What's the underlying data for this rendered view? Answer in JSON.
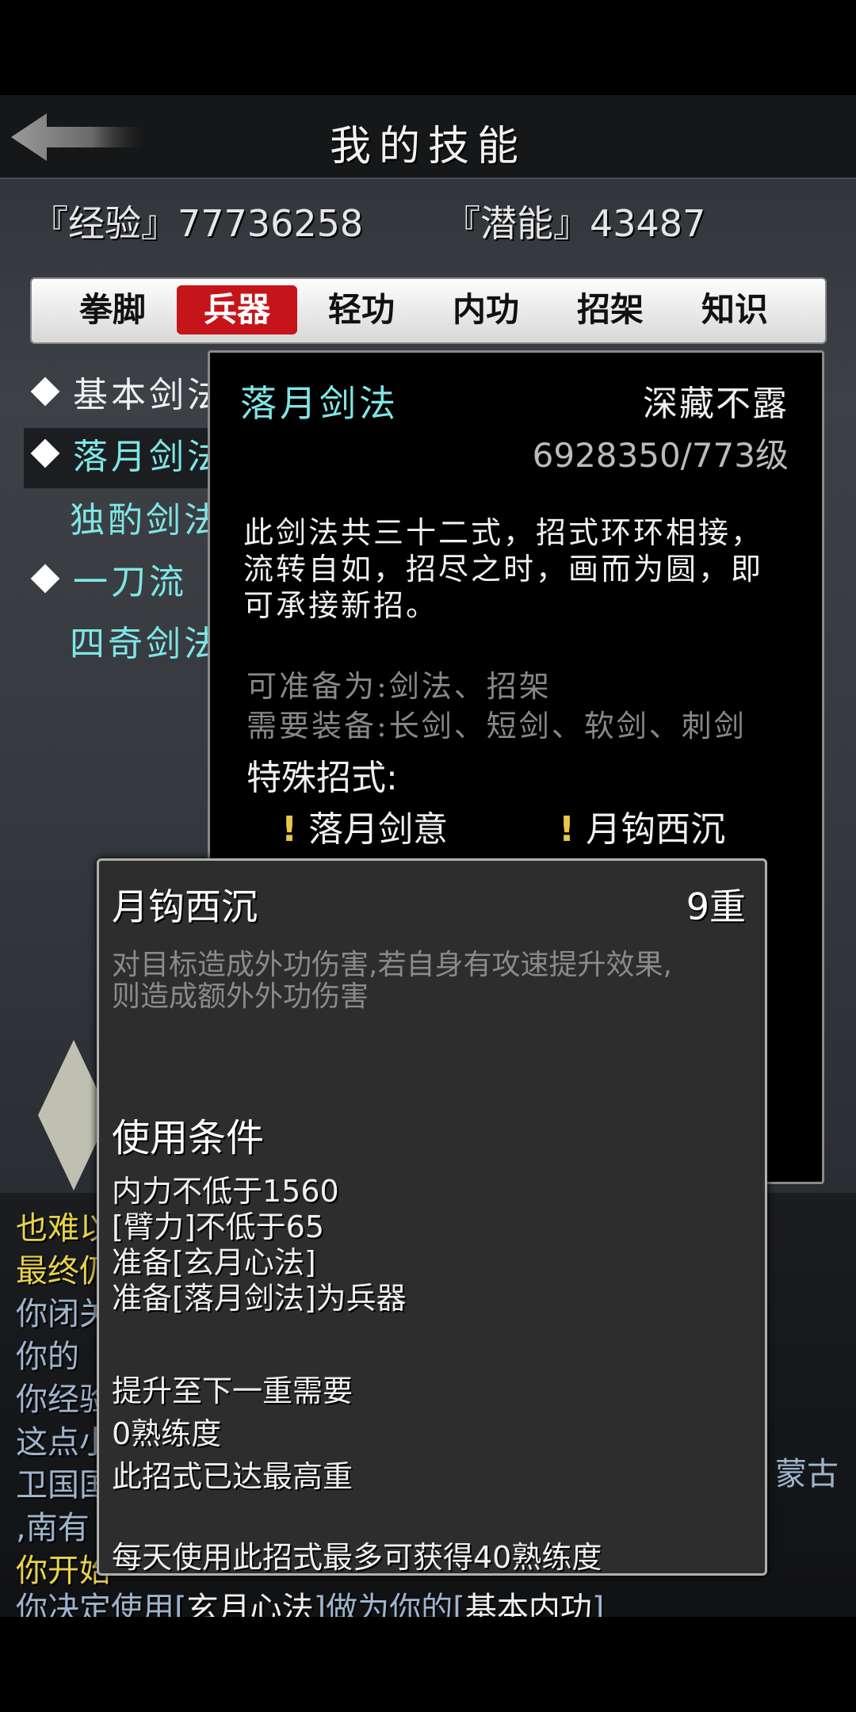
{
  "header": {
    "title": "我的技能",
    "back_icon": "back-arrow-icon"
  },
  "stats": {
    "exp": "『经验』77736258",
    "potential": "『潜能』43487"
  },
  "tabs": [
    {
      "label": "拳脚",
      "active": false
    },
    {
      "label": "兵器",
      "active": true
    },
    {
      "label": "轻功",
      "active": false
    },
    {
      "label": "内功",
      "active": false
    },
    {
      "label": "招架",
      "active": false
    },
    {
      "label": "知识",
      "active": false
    }
  ],
  "skills": [
    {
      "label": "基本剑法",
      "marked": true,
      "color": "white"
    },
    {
      "label": "落月剑法",
      "marked": true,
      "color": "cyan",
      "selected": true
    },
    {
      "label": "独酌剑法",
      "marked": false,
      "color": "cyan"
    },
    {
      "label": "一刀流",
      "marked": true,
      "color": "cyan"
    },
    {
      "label": "四奇剑法",
      "marked": false,
      "color": "cyan"
    }
  ],
  "detail": {
    "name": "落月剑法",
    "rank": "深藏不露",
    "level": "6928350/773级",
    "desc": [
      "此剑法共三十二式，招式环环相接，",
      "流转自如，招尽之时，画而为圆，即",
      "可承接新招。"
    ],
    "prepare": "可准备为:剑法、招架",
    "equip": "需要装备:长剑、短剑、软剑、刺剑",
    "special_title": "特殊招式:",
    "moves": [
      "落月剑意",
      "月钩西沉"
    ],
    "move_marker": "!"
  },
  "popup": {
    "name": "月钩西沉",
    "level": "9重",
    "desc": [
      "对目标造成外功伤害,若自身有攻速提升效果,",
      "则造成额外外功伤害"
    ],
    "cond_title": "使用条件",
    "conds": [
      "内力不低于1560",
      "[臂力]不低于65",
      "准备[玄月心法]",
      "准备[落月剑法]为兵器"
    ],
    "next_title": "提升至下一重需要",
    "next_req": "0熟练度",
    "max_note": "此招式已达最高重",
    "daily_note": "每天使用此招式最多可获得40熟练度"
  },
  "log": {
    "lines": [
      {
        "text": "也难以",
        "color": "yellow"
      },
      {
        "text": "最终仍",
        "color": "yellow"
      },
      {
        "text": "你闭关",
        "color": "blue"
      },
      {
        "text": "你的",
        "color": "blue"
      },
      {
        "text": "你经验",
        "color": "blue"
      },
      {
        "text": "这点小",
        "color": "blue"
      },
      {
        "text": "卫国国",
        "color": "blue"
      },
      {
        "text": ",南有",
        "color": "blue"
      },
      {
        "text": "你开始",
        "color": "yellow"
      }
    ],
    "right_fragment": "蒙古",
    "last": {
      "pre": "你决定使用[",
      "a": "玄月心法",
      "mid": "]做为你的[",
      "b": "基本内功",
      "post": "]"
    }
  },
  "colors": {
    "accent_red": "#c5151b",
    "skill_cyan": "#7fe6e6",
    "log_blue": "#9fb4cc",
    "log_yellow": "#e8d24a"
  }
}
